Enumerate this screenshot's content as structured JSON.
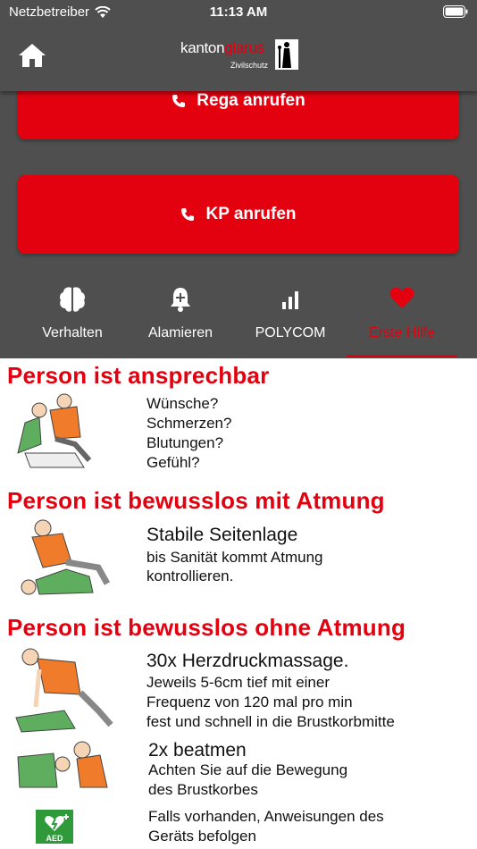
{
  "status": {
    "carrier": "Netzbetreiber",
    "time": "11:13 AM"
  },
  "header": {
    "logo_kanton": "kanton",
    "logo_glarus": "glarus",
    "logo_sub": "Zivilschutz"
  },
  "buttons": {
    "rega": "Rega anrufen",
    "kp": "KP anrufen"
  },
  "tabs": [
    {
      "label": "Verhalten",
      "icon": "brain-icon"
    },
    {
      "label": "Alamieren",
      "icon": "bell-plus-icon"
    },
    {
      "label": "POLYCOM",
      "icon": "signal-bars-icon"
    },
    {
      "label": "Erste Hilfe",
      "icon": "heart-icon"
    }
  ],
  "colors": {
    "accent": "#e3000f",
    "background": "#4f4f4f"
  },
  "first_aid": {
    "s1": {
      "heading": "Person ist ansprechbar",
      "lines": [
        "Wünsche?",
        "Schmerzen?",
        "Blutungen?",
        "Gefühl?"
      ]
    },
    "s2": {
      "heading": "Person ist bewusslos mit Atmung",
      "title": "Stabile Seitenlage",
      "lines": [
        "bis Sanität kommt Atmung",
        "kontrollieren."
      ]
    },
    "s3": {
      "heading": "Person ist bewusslos ohne Atmung",
      "title": "30x Herzdruckmassage.",
      "lines": [
        "Jeweils 5-6cm tief mit einer",
        "Frequenz von 120 mal pro min",
        "fest und schnell in die Brustkorbmitte"
      ]
    },
    "s4": {
      "title": "2x beatmen",
      "lines": [
        "Achten Sie auf die Bewegung",
        "des Brustkorbes"
      ]
    },
    "s5": {
      "aed_label": "AED",
      "lines": [
        "Falls vorhanden, Anweisungen des",
        "Geräts befolgen"
      ]
    }
  }
}
